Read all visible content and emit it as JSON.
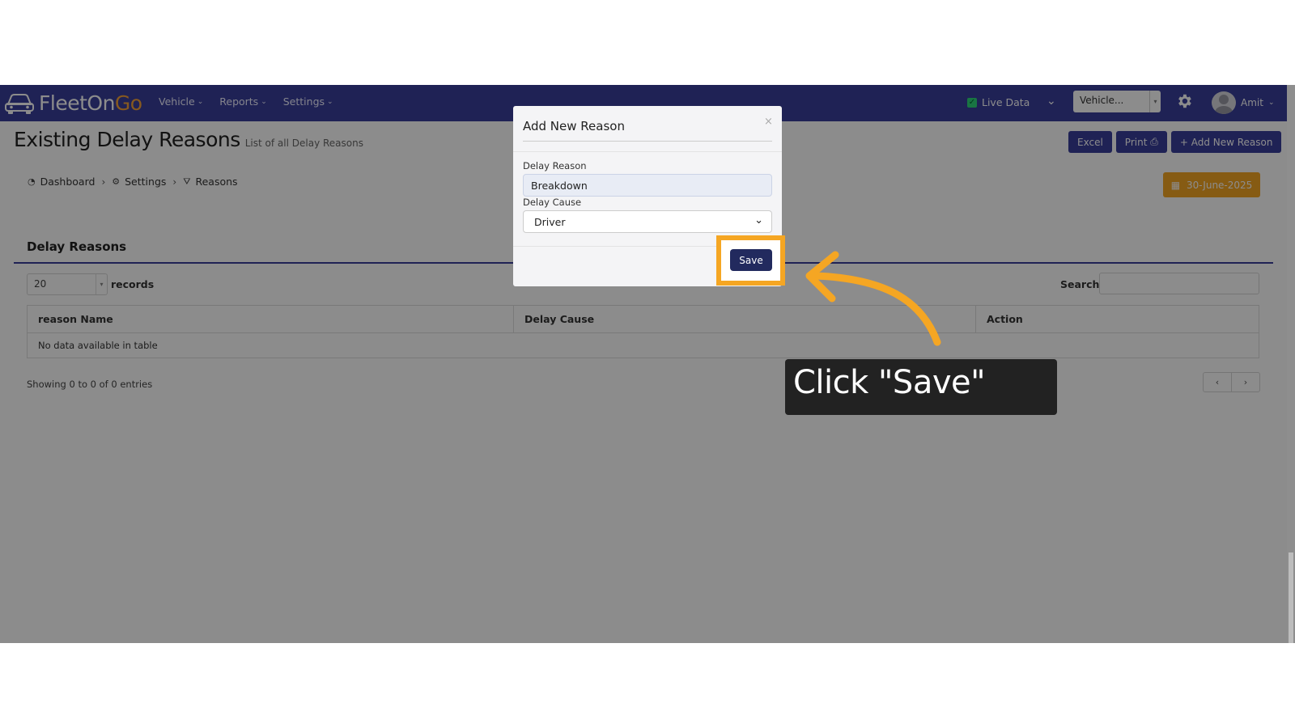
{
  "app": {
    "logo_main": "FleetOn",
    "logo_accent": "Go"
  },
  "nav": {
    "items": [
      {
        "label": "Vehicle"
      },
      {
        "label": "Reports"
      },
      {
        "label": "Settings"
      }
    ],
    "live_data_label": "Live Data",
    "vehicle_select_value": "Vehicle...",
    "user_name": "Amit"
  },
  "page": {
    "title": "Existing Delay Reasons",
    "subtitle": "List of all Delay Reasons",
    "buttons": {
      "excel": "Excel",
      "print": "Print",
      "add_new": "+ Add New Reason"
    },
    "breadcrumb": {
      "dashboard": "Dashboard",
      "settings": "Settings",
      "reasons": "Reasons"
    },
    "date": "30-June-2025"
  },
  "card": {
    "title": "Delay Reasons",
    "records_value": "20",
    "records_label": "records",
    "search_label": "Search:",
    "columns": [
      "reason Name",
      "Delay Cause",
      "Action"
    ],
    "empty_text": "No data available in table",
    "showing_text": "Showing 0 to 0 of 0 entries",
    "pager": {
      "prev": "‹",
      "next": "›"
    }
  },
  "modal": {
    "title": "Add New Reason",
    "close": "×",
    "delay_reason_label": "Delay Reason",
    "delay_reason_value": "Breakdown",
    "delay_cause_label": "Delay Cause",
    "delay_cause_value": "Driver",
    "save_label": "Save"
  },
  "callout": {
    "text": "Click \"Save\""
  },
  "colors": {
    "navbar": "#3a3f9c",
    "accent": "#f5a623",
    "save_button": "#222a5e"
  }
}
